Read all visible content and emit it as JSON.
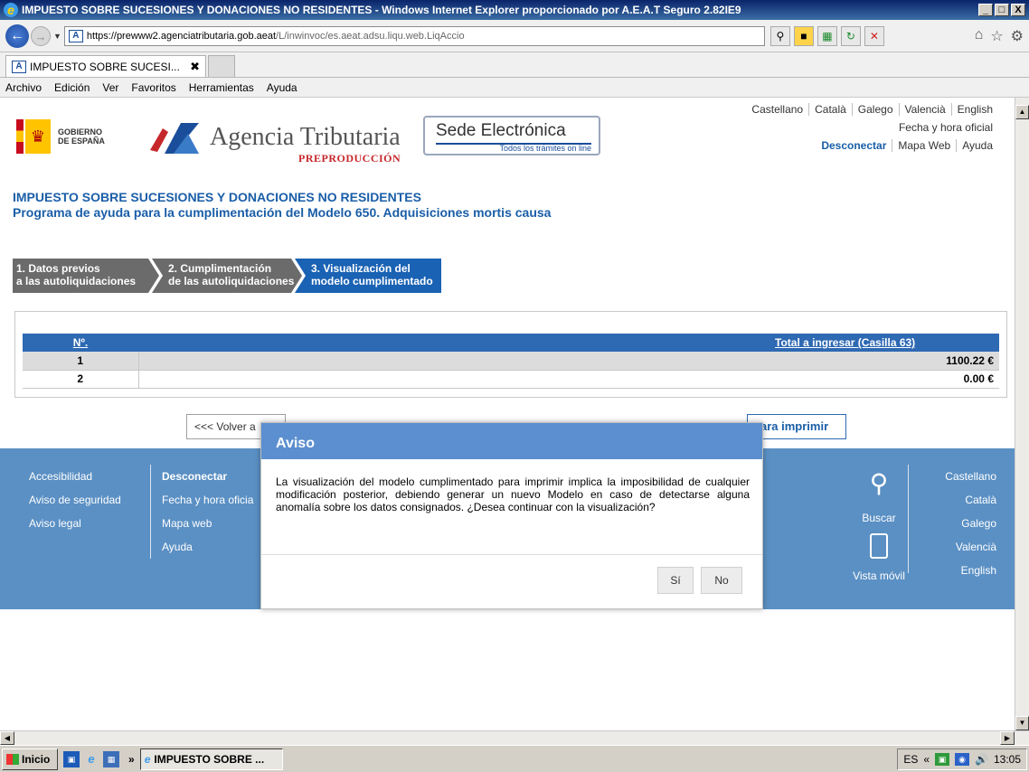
{
  "window": {
    "title": "IMPUESTO SOBRE SUCESIONES Y DONACIONES NO RESIDENTES - Windows Internet Explorer proporcionado por A.E.A.T Seguro 2.82IE9",
    "min": "_",
    "max": "□",
    "close": "X"
  },
  "address": {
    "url_host": "https://prewww2.agenciatributaria.gob.aeat",
    "url_path": "/L/inwinvoc/es.aeat.adsu.liqu.web.LiqAccio"
  },
  "tab": {
    "title": "IMPUESTO SOBRE SUCESI...",
    "close": "✖"
  },
  "menu": [
    "Archivo",
    "Edición",
    "Ver",
    "Favoritos",
    "Herramientas",
    "Ayuda"
  ],
  "header": {
    "languages": [
      "Castellano",
      "Català",
      "Galego",
      "Valencià",
      "English"
    ],
    "fecha": "Fecha y hora oficial",
    "links": [
      "Desconectar",
      "Mapa Web",
      "Ayuda"
    ],
    "gobierno_line1": "GOBIERNO",
    "gobierno_line2": "DE ESPAÑA",
    "agency": "Agencia Tributaria",
    "agency_env": "PREPRODUCCIÓN",
    "sede_title": "Sede Electrónica",
    "sede_sub": "Todos los trámites on line",
    "colors": {
      "brand_blue": "#1a5ea8",
      "footer_blue": "#5b90c4",
      "modal_head": "#5b8fcf"
    }
  },
  "page": {
    "title_line1": "IMPUESTO SOBRE SUCESIONES Y DONACIONES NO RESIDENTES",
    "title_line2": "Programa de ayuda para la cumplimentación del Modelo 650. Adquisiciones mortis causa"
  },
  "steps": [
    {
      "line1": "1. Datos previos",
      "line2": "a las autoliquidaciones"
    },
    {
      "line1": "2. Cumplimentación",
      "line2": "de las autoliquidaciones"
    },
    {
      "line1": "3. Visualización del",
      "line2": "modelo cumplimentado"
    }
  ],
  "table": {
    "headers": [
      "Nº.",
      "",
      "Total a ingresar (Casilla 63)"
    ],
    "rows": [
      {
        "n": "1",
        "total": "1100.22 €"
      },
      {
        "n": "2",
        "total": "0.00 €"
      }
    ]
  },
  "buttons": {
    "volver": "<<< Volver a",
    "imprimir": "ara imprimir"
  },
  "footer": {
    "col1": [
      "Accesibilidad",
      "Aviso de seguridad",
      "Aviso legal"
    ],
    "col2": [
      "Desconectar",
      "Fecha y hora oficia",
      "Mapa web",
      "Ayuda"
    ],
    "search": "Buscar",
    "mobile": "Vista móvil",
    "languages": [
      "Castellano",
      "Català",
      "Galego",
      "Valencià",
      "English"
    ]
  },
  "modal": {
    "title": "Aviso",
    "body": "La visualización del modelo cumplimentado para imprimir implica la imposibilidad de cualquier modificación posterior, debiendo generar un nuevo Modelo en caso de detectarse alguna anomalía sobre los datos consignados. ¿Desea continuar con la visualización?",
    "yes": "Sí",
    "no": "No"
  },
  "taskbar": {
    "start": "Inicio",
    "chevron": "»",
    "item": "IMPUESTO SOBRE ...",
    "lang": "ES",
    "tray_chevron": "«",
    "clock": "13:05"
  }
}
